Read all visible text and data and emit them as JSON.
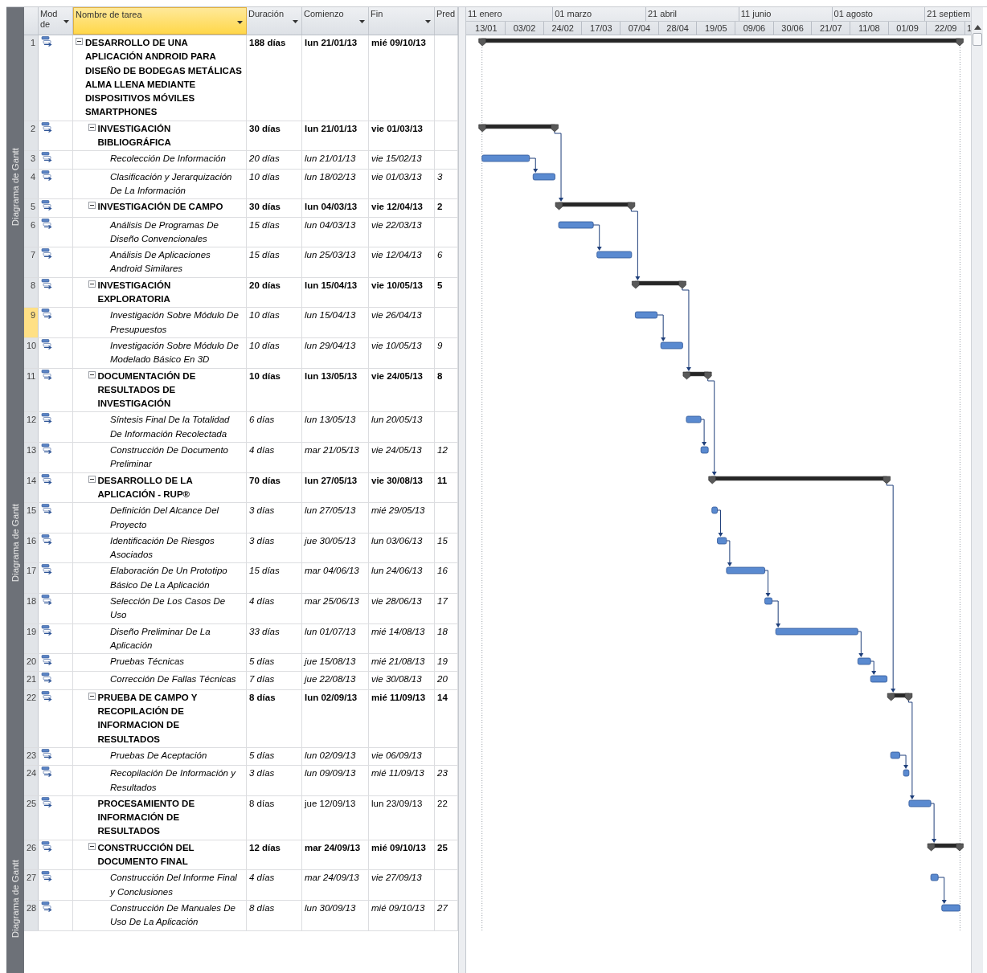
{
  "view_bar": {
    "labels": [
      "Diagrama de Gantt",
      "Diagrama de Gantt",
      "Diagrama de Gantt"
    ]
  },
  "columns": [
    {
      "label": "Mod de",
      "selected": false,
      "caret": true
    },
    {
      "label": "Nombre de tarea",
      "selected": true,
      "caret": true
    },
    {
      "label": "Duración",
      "selected": false,
      "caret": true
    },
    {
      "label": "Comienzo",
      "selected": false,
      "caret": true
    },
    {
      "label": "Fin",
      "selected": false,
      "caret": true
    },
    {
      "label": "Pred",
      "selected": false,
      "caret": false
    }
  ],
  "timescale": {
    "major": [
      "11 enero",
      "01 marzo",
      "21 abril",
      "11 junio",
      "01 agosto",
      "21 septiem"
    ],
    "minor": [
      "13/01",
      "03/02",
      "24/02",
      "17/03",
      "07/04",
      "28/04",
      "19/05",
      "09/06",
      "30/06",
      "21/07",
      "11/08",
      "01/09",
      "22/09",
      "1"
    ]
  },
  "tasks": [
    {
      "id": "1",
      "name": "DESARROLLO DE UNA APLICACIÓN ANDROID PARA DISEÑO DE BODEGAS METÁLICAS ALMA LLENA MEDIANTE DISPOSITIVOS MÓVILES SMARTPHONES",
      "duration": "188 días",
      "start": "lun 21/01/13",
      "finish": "mié 09/10/13",
      "kind": "summary",
      "expanded": true,
      "selected": false,
      "children": [
        {
          "id": "2",
          "name": "INVESTIGACIÓN BIBLIOGRÁFICA",
          "duration": "30 días",
          "start": "lun 21/01/13",
          "finish": "vie 01/03/13",
          "kind": "summary",
          "expanded": true,
          "selected": false,
          "children": [
            {
              "id": "3",
              "name": "Recolección De Información",
              "duration": "20 días",
              "start": "lun 21/01/13",
              "finish": "vie 15/02/13",
              "kind": "task",
              "selected": false
            },
            {
              "id": "4",
              "name": "Clasificación y Jerarquización De La Información",
              "duration": "10 días",
              "start": "lun 18/02/13",
              "finish": "vie 01/03/13",
              "pred": "3",
              "kind": "task",
              "selected": false
            }
          ]
        },
        {
          "id": "5",
          "name": "INVESTIGACIÓN DE CAMPO",
          "duration": "30 días",
          "start": "lun 04/03/13",
          "finish": "vie 12/04/13",
          "pred": "2",
          "kind": "summary",
          "expanded": true,
          "selected": false,
          "children": [
            {
              "id": "6",
              "name": "Análisis De Programas De Diseño Convencionales",
              "duration": "15 días",
              "start": "lun 04/03/13",
              "finish": "vie 22/03/13",
              "kind": "task",
              "selected": false
            },
            {
              "id": "7",
              "name": "Análisis De Aplicaciones Android Similares",
              "duration": "15 días",
              "start": "lun 25/03/13",
              "finish": "vie 12/04/13",
              "pred": "6",
              "kind": "task",
              "selected": false
            }
          ]
        },
        {
          "id": "8",
          "name": "INVESTIGACIÓN EXPLORATORIA",
          "duration": "20 días",
          "start": "lun 15/04/13",
          "finish": "vie 10/05/13",
          "pred": "5",
          "kind": "summary",
          "expanded": true,
          "selected": false,
          "children": [
            {
              "id": "9",
              "name": "Investigación Sobre Módulo De Presupuestos",
              "duration": "10 días",
              "start": "lun 15/04/13",
              "finish": "vie 26/04/13",
              "kind": "task",
              "selected": true
            },
            {
              "id": "10",
              "name": "Investigación Sobre Módulo De Modelado Básico En 3D",
              "duration": "10 días",
              "start": "lun 29/04/13",
              "finish": "vie 10/05/13",
              "pred": "9",
              "kind": "task",
              "selected": false
            }
          ]
        },
        {
          "id": "11",
          "name": "DOCUMENTACIÓN DE RESULTADOS DE INVESTIGACIÓN",
          "duration": "10 días",
          "start": "lun 13/05/13",
          "finish": "vie 24/05/13",
          "pred": "8",
          "kind": "summary",
          "expanded": true,
          "selected": false,
          "children": [
            {
              "id": "12",
              "name": "Síntesis Final De la Totalidad De Información Recolectada",
              "duration": "6 días",
              "start": "lun 13/05/13",
              "finish": "lun 20/05/13",
              "kind": "task",
              "selected": false
            },
            {
              "id": "13",
              "name": "Construcción De Documento Preliminar",
              "duration": "4 días",
              "start": "mar 21/05/13",
              "finish": "vie 24/05/13",
              "pred": "12",
              "kind": "task",
              "selected": false
            }
          ]
        },
        {
          "id": "14",
          "name": "DESARROLLO DE LA APLICACIÓN - RUP®",
          "duration": "70 días",
          "start": "lun 27/05/13",
          "finish": "vie 30/08/13",
          "pred": "11",
          "kind": "summary",
          "expanded": true,
          "selected": false,
          "children": [
            {
              "id": "15",
              "name": "Definición Del Alcance Del Proyecto",
              "duration": "3 días",
              "start": "lun 27/05/13",
              "finish": "mié 29/05/13",
              "kind": "task",
              "selected": false
            },
            {
              "id": "16",
              "name": "Identificación De Riesgos Asociados",
              "duration": "3 días",
              "start": "jue 30/05/13",
              "finish": "lun 03/06/13",
              "pred": "15",
              "kind": "task",
              "selected": false
            },
            {
              "id": "17",
              "name": "Elaboración De Un Prototipo Básico De La Aplicación",
              "duration": "15 días",
              "start": "mar 04/06/13",
              "finish": "lun 24/06/13",
              "pred": "16",
              "kind": "task",
              "selected": false
            },
            {
              "id": "18",
              "name": "Selección De Los Casos De Uso",
              "duration": "4 días",
              "start": "mar 25/06/13",
              "finish": "vie 28/06/13",
              "pred": "17",
              "kind": "task",
              "selected": false
            },
            {
              "id": "19",
              "name": "Diseño Preliminar De La Aplicación",
              "duration": "33 días",
              "start": "lun 01/07/13",
              "finish": "mié 14/08/13",
              "pred": "18",
              "kind": "task",
              "selected": false
            },
            {
              "id": "20",
              "name": "Pruebas Técnicas",
              "duration": "5 días",
              "start": "jue 15/08/13",
              "finish": "mié 21/08/13",
              "pred": "19",
              "kind": "task",
              "selected": false
            },
            {
              "id": "21",
              "name": "Corrección De Fallas Técnicas",
              "duration": "7 días",
              "start": "jue 22/08/13",
              "finish": "vie 30/08/13",
              "pred": "20",
              "kind": "task",
              "selected": false
            }
          ]
        },
        {
          "id": "22",
          "name": "PRUEBA DE CAMPO Y RECOPILACIÓN DE INFORMACION DE RESULTADOS",
          "duration": "8 días",
          "start": "lun 02/09/13",
          "finish": "mié 11/09/13",
          "pred": "14",
          "kind": "summary",
          "expanded": true,
          "selected": false,
          "children": [
            {
              "id": "23",
              "name": "Pruebas De Aceptación",
              "duration": "5 días",
              "start": "lun 02/09/13",
              "finish": "vie 06/09/13",
              "kind": "task",
              "selected": false
            },
            {
              "id": "24",
              "name": "Recopilación De Información y Resultados",
              "duration": "3 días",
              "start": "lun 09/09/13",
              "finish": "mié 11/09/13",
              "pred": "23",
              "kind": "task",
              "selected": false
            }
          ]
        },
        {
          "id": "25",
          "name": "PROCESAMIENTO DE INFORMACIÓN DE RESULTADOS",
          "duration": "8 días",
          "start": "jue 12/09/13",
          "finish": "lun 23/09/13",
          "pred": "22",
          "kind": "heading",
          "selected": false
        },
        {
          "id": "26",
          "name": "CONSTRUCCIÓN DEL DOCUMENTO FINAL",
          "duration": "12 días",
          "start": "mar 24/09/13",
          "finish": "mié 09/10/13",
          "pred": "25",
          "kind": "summary",
          "expanded": true,
          "selected": false,
          "children": [
            {
              "id": "27",
              "name": "Construcción Del Informe Final y Conclusiones",
              "duration": "4 días",
              "start": "mar 24/09/13",
              "finish": "vie 27/09/13",
              "kind": "task",
              "selected": false
            },
            {
              "id": "28",
              "name": "Construcción De Manuales De Uso De La Aplicación",
              "duration": "8 días",
              "start": "lun 30/09/13",
              "finish": "mié 09/10/13",
              "pred": "27",
              "kind": "task",
              "selected": false
            }
          ]
        }
      ]
    }
  ]
}
